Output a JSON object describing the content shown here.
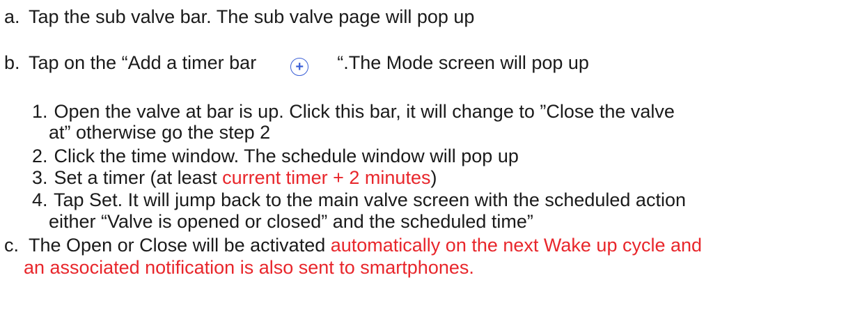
{
  "steps": {
    "a": {
      "label": "a.",
      "text": "Tap the sub valve bar. The sub valve page will pop up"
    },
    "b": {
      "label": "b.",
      "text_before": "Tap on the “Add a timer bar",
      "text_after": "“.The Mode screen will pop up",
      "icon": "plus-circle-icon"
    },
    "sub": [
      {
        "num": "1.",
        "line1": "Open the valve at bar is up. Click this bar, it will change to ”Close the valve",
        "line2": "at” otherwise go the step 2"
      },
      {
        "num": "2.",
        "line1": "Click the time window. The schedule window will pop up"
      },
      {
        "num": "3.",
        "text_before": "Set a timer (at least ",
        "highlight": "current timer + 2 minutes",
        "text_after": ")"
      },
      {
        "num": "4.",
        "line1": "Tap Set. It will jump back to the main valve screen with the scheduled action",
        "line2": "either “Valve is opened or closed” and the scheduled time”"
      }
    ],
    "c": {
      "label": "c.",
      "text_before": "The Open or Close will be activated ",
      "highlight1": "automatically on the next Wake up cycle and",
      "highlight2": "an associated notification is also sent to smartphones."
    }
  },
  "colors": {
    "text": "#1a1a1a",
    "highlight": "#e8262b",
    "icon": "#3b5fd6"
  }
}
